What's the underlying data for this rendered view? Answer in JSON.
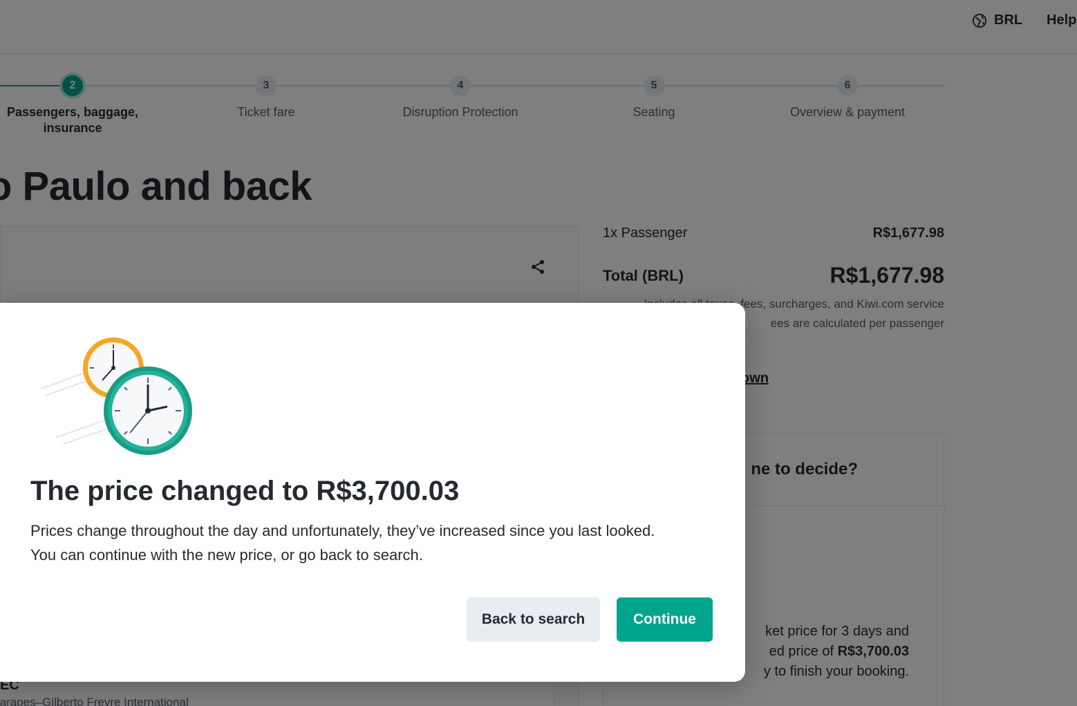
{
  "header": {
    "currency": "BRL",
    "help": "Help"
  },
  "stepper": {
    "steps": [
      {
        "number": "2",
        "label_line1": "Passengers, baggage,",
        "label_line2": "insurance",
        "active": true
      },
      {
        "number": "3",
        "label_line1": "Ticket fare",
        "label_line2": ""
      },
      {
        "number": "4",
        "label_line1": "Disruption Protection",
        "label_line2": ""
      },
      {
        "number": "5",
        "label_line1": "Seating",
        "label_line2": ""
      },
      {
        "number": "6",
        "label_line1": "Overview & payment",
        "label_line2": ""
      }
    ]
  },
  "page": {
    "title": "o Paulo and back"
  },
  "itinerary": {
    "airport_code": "EC",
    "airport_name": "rarapes–Gilberto Freyre International"
  },
  "summary": {
    "passenger_label": "1x Passenger",
    "passenger_price": "R$1,677.98",
    "total_label": "Total (BRL)",
    "total_price": "R$1,677.98",
    "note_line1": "Includes all taxes, fees, surcharges, and Kiwi.com service",
    "note_line2": "ees are calculated per passenger",
    "breakdown_link": "own"
  },
  "decide_card": {
    "title": "ne to decide?",
    "body_line1": "ket price for 3 days and",
    "body_line2_prefix": "ed price of ",
    "body_line2_price": "R$3,700.03",
    "body_line3": "y to finish your booking."
  },
  "modal": {
    "title": "The price changed to R$3,700.03",
    "description_line1": "Prices change throughout the day and unfortunately, they’ve increased since you last looked.",
    "description_line2": "You can continue with the new price, or go back to search.",
    "back_button": "Back to search",
    "continue_button": "Continue"
  },
  "colors": {
    "brand_primary": "#00a58e",
    "text_primary": "#252a31",
    "text_secondary": "#4f5e71",
    "button_secondary_bg": "#e8edf1",
    "clock_orange": "#f5a623",
    "clock_teal": "#1a9b86"
  }
}
